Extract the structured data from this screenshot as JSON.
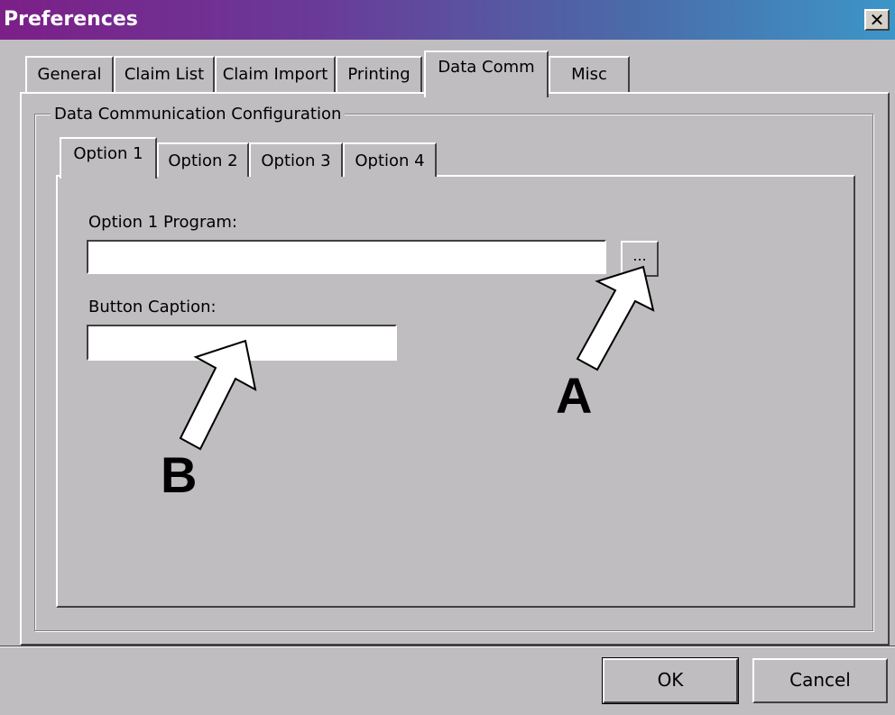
{
  "window": {
    "title": "Preferences",
    "close_glyph": "✕"
  },
  "tabs": [
    {
      "label": "General"
    },
    {
      "label": "Claim List"
    },
    {
      "label": "Claim Import"
    },
    {
      "label": "Printing"
    },
    {
      "label": "Data Comm",
      "active": true
    },
    {
      "label": "Misc"
    }
  ],
  "group": {
    "title": "Data Communication Configuration"
  },
  "option_tabs": [
    {
      "label": "Option 1",
      "active": true
    },
    {
      "label": "Option 2"
    },
    {
      "label": "Option 3"
    },
    {
      "label": "Option 4"
    }
  ],
  "form": {
    "program_label": "Option 1 Program:",
    "program_value": "",
    "browse_label": "...",
    "caption_label": "Button Caption:",
    "caption_value": ""
  },
  "buttons": {
    "ok": "OK",
    "cancel": "Cancel"
  },
  "callouts": {
    "a": "A",
    "b": "B"
  },
  "colors": {
    "title_gradient_start": "#7c1f88",
    "title_gradient_end": "#3c96c8",
    "face": "#c0bdc0"
  }
}
